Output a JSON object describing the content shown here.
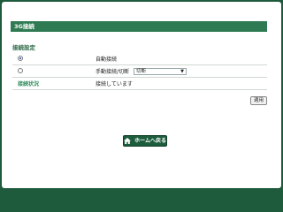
{
  "header": {
    "title": "3G接続"
  },
  "settings": {
    "section_label": "接続設定",
    "options": [
      {
        "label": "自動接続",
        "selected": true
      },
      {
        "label": "手動接続/切断",
        "selected": false,
        "select_value": "切断"
      }
    ],
    "status_label": "接続状況",
    "status_value": "接続しています"
  },
  "actions": {
    "apply_label": "適用",
    "home_label": "ホームへ戻る"
  },
  "colors": {
    "background": "#1e5a3c",
    "title_bar": "#2e7a52",
    "accent_text": "#2e8a5a"
  }
}
